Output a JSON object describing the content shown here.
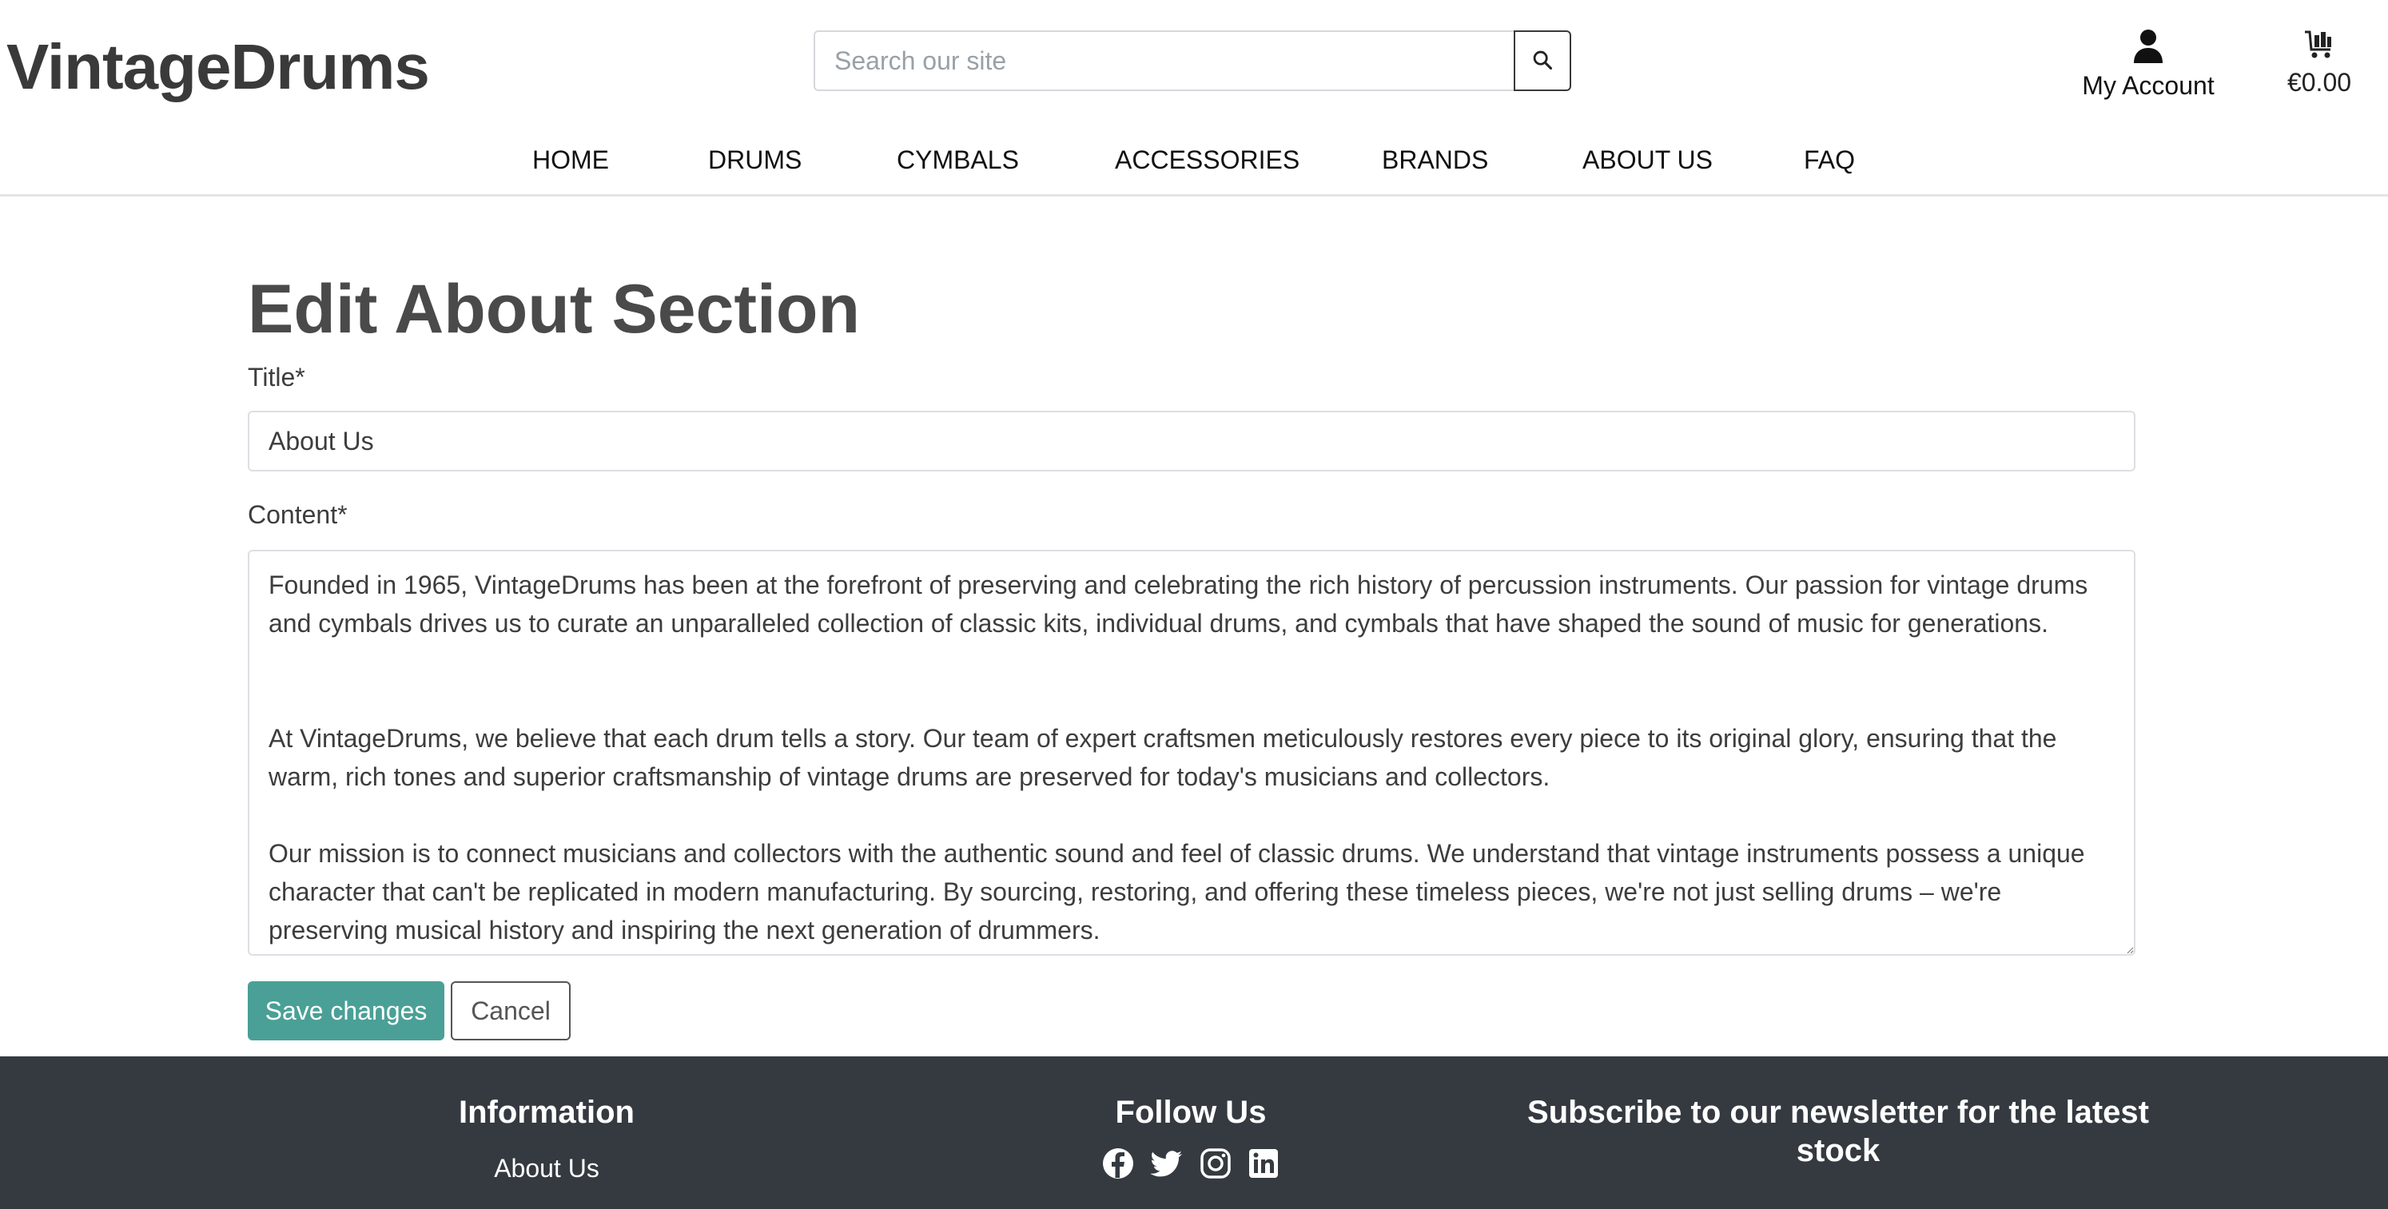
{
  "header": {
    "logo": "VintageDrums",
    "search_placeholder": "Search our site",
    "search_icon": "search-icon",
    "account_label": "My Account",
    "account_icon": "user-icon",
    "cart_total": "€0.00",
    "cart_icon": "cart-icon"
  },
  "nav": [
    "HOME",
    "DRUMS",
    "CYMBALS",
    "ACCESSORIES",
    "BRANDS",
    "ABOUT US",
    "FAQ"
  ],
  "form": {
    "heading": "Edit About Section",
    "title_label": "Title*",
    "title_value": "About Us",
    "content_label": "Content*",
    "content_value": "Founded in 1965, VintageDrums has been at the forefront of preserving and celebrating the rich history of percussion instruments. Our passion for vintage drums and cymbals drives us to curate an unparalleled collection of classic kits, individual drums, and cymbals that have shaped the sound of music for generations.\n\n\nAt VintageDrums, we believe that each drum tells a story. Our team of expert craftsmen meticulously restores every piece to its original glory, ensuring that the warm, rich tones and superior craftsmanship of vintage drums are preserved for today's musicians and collectors.\n\nOur mission is to connect musicians and collectors with the authentic sound and feel of classic drums. We understand that vintage instruments possess a unique character that can't be replicated in modern manufacturing. By sourcing, restoring, and offering these timeless pieces, we're not just selling drums – we're preserving musical history and inspiring the next generation of drummers.",
    "save_label": "Save changes",
    "cancel_label": "Cancel"
  },
  "footer": {
    "info_heading": "Information",
    "info_link": "About Us",
    "follow_heading": "Follow Us",
    "social_icons": [
      "facebook-icon",
      "twitter-icon",
      "instagram-icon",
      "linkedin-icon"
    ],
    "newsletter_heading": "Subscribe to our newsletter for the latest stock"
  },
  "colors": {
    "accent": "#4aa096",
    "footer_bg": "#343a40",
    "heading": "#4a4a4a"
  }
}
